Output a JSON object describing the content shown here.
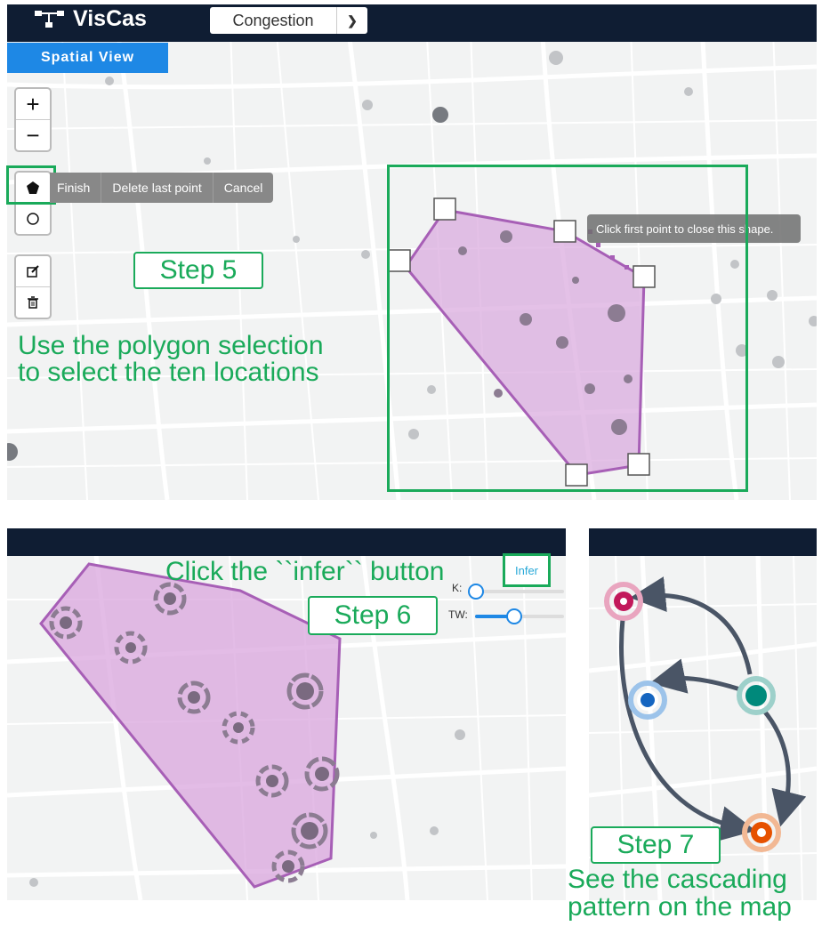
{
  "app": {
    "name": "VisCas",
    "dropdown_value": "Congestion",
    "tab_label": "Spatial View"
  },
  "draw_toolbar": {
    "zoom_in": "+",
    "zoom_out": "−",
    "finish": "Finish",
    "delete_last_point": "Delete last point",
    "cancel": "Cancel",
    "tooltip": "Click first point to close this shape."
  },
  "steps": {
    "step5_label": "Step 5",
    "step5_desc_line1": "Use the polygon selection",
    "step5_desc_line2": "to select the ten locations",
    "step6_label": "Step 6",
    "step6_desc": "Click the ``infer`` button",
    "step7_label": "Step 7",
    "step7_desc_line1": "See the cascading",
    "step7_desc_line2": "pattern on the map"
  },
  "infer_panel": {
    "button_label": "Infer",
    "k_label": "K:",
    "k_value": 0,
    "tw_label": "TW:",
    "tw_value": 0.43
  },
  "colors": {
    "header": "#0f1d33",
    "tab": "#1e88e5",
    "selection_fill": "#d9a6dd",
    "selection_stroke": "#a75fb6",
    "annotation_green": "#1aaa5a",
    "node_pink": "#c2185b",
    "node_blue": "#1565c0",
    "node_teal": "#00897b",
    "node_orange": "#e65100",
    "arrow": "#4a5566"
  },
  "icons": [
    "logo-icon",
    "chevron-down-icon",
    "pentagon-icon",
    "circle-icon",
    "edit-icon",
    "trash-icon"
  ]
}
